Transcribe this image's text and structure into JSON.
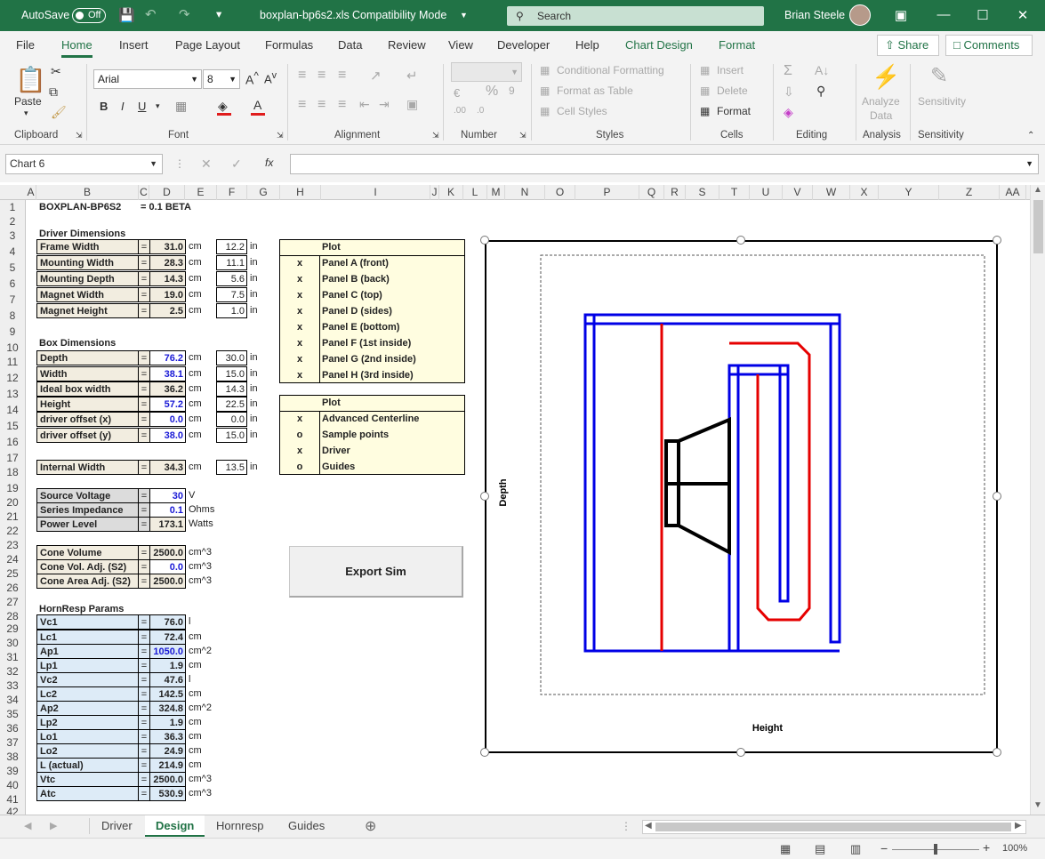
{
  "title": {
    "autosave": "AutoSave",
    "autosave_state": "Off",
    "filename": "boxplan-bp6s2.xls",
    "mode": "Compatibility Mode",
    "search_placeholder": "Search",
    "user": "Brian Steele"
  },
  "menu": [
    "File",
    "Home",
    "Insert",
    "Page Layout",
    "Formulas",
    "Data",
    "Review",
    "View",
    "Developer",
    "Help",
    "Chart Design",
    "Format"
  ],
  "share": "Share",
  "comments": "Comments",
  "ribbon": {
    "clipboard": "Clipboard",
    "paste": "Paste",
    "font": "Font",
    "font_name": "Arial",
    "font_size": "8",
    "alignment": "Alignment",
    "number": "Number",
    "styles": "Styles",
    "conditional_formatting": "Conditional Formatting",
    "format_as_table": "Format as Table",
    "cell_styles": "Cell Styles",
    "cells": "Cells",
    "insert": "Insert",
    "delete": "Delete",
    "format": "Format",
    "editing": "Editing",
    "analysis": "Analysis",
    "analyze_data_1": "Analyze",
    "analyze_data_2": "Data",
    "sensitivity": "Sensitivity"
  },
  "namebox": "Chart 6",
  "columns": [
    "A",
    "B",
    "C",
    "D",
    "E",
    "F",
    "G",
    "H",
    "I",
    "J",
    "K",
    "L",
    "M",
    "N",
    "O",
    "P",
    "Q",
    "R",
    "S",
    "T",
    "U",
    "V",
    "W",
    "X",
    "Y",
    "Z",
    "AA"
  ],
  "rows": [
    "1",
    "2",
    "3",
    "4",
    "5",
    "6",
    "7",
    "8",
    "9",
    "10",
    "11",
    "12",
    "13",
    "14",
    "15",
    "16",
    "17",
    "18",
    "19",
    "20",
    "21",
    "22",
    "23",
    "24",
    "25",
    "26",
    "27",
    "28",
    "29",
    "30",
    "31",
    "32",
    "33",
    "34",
    "35",
    "36",
    "37",
    "38",
    "39",
    "40",
    "41",
    "42"
  ],
  "sheet": {
    "r1_title": "BOXPLAN-BP6S2",
    "r1_version": "=  0.1 BETA",
    "driver_dim": "Driver Dimensions",
    "box_dim": "Box Dimensions",
    "hr_params": "HornResp Params",
    "eq": "=",
    "cm": "cm",
    "in": "in",
    "v": "V",
    "ohms": "Ohms",
    "watts": "Watts",
    "cm3": "cm^3",
    "cm2": "cm^2",
    "l": "l",
    "driver": [
      {
        "label": "Frame Width",
        "v": "31.0",
        "i": "12.2"
      },
      {
        "label": "Mounting Width",
        "v": "28.3",
        "i": "11.1"
      },
      {
        "label": "Mounting Depth",
        "v": "14.3",
        "i": "5.6"
      },
      {
        "label": "Magnet Width",
        "v": "19.0",
        "i": "7.5"
      },
      {
        "label": "Magnet Height",
        "v": "2.5",
        "i": "1.0"
      }
    ],
    "box": [
      {
        "label": "Depth",
        "v": "76.2",
        "i": "30.0"
      },
      {
        "label": "Width",
        "v": "38.1",
        "i": "15.0"
      },
      {
        "label": "Ideal box width",
        "v": "36.2",
        "i": "14.3"
      },
      {
        "label": "Height",
        "v": "57.2",
        "i": "22.5"
      },
      {
        "label": "driver offset (x)",
        "v": "0.0",
        "i": "0.0"
      },
      {
        "label": "driver offset (y)",
        "v": "38.0",
        "i": "15.0"
      }
    ],
    "internal": {
      "label": "Internal Width",
      "v": "34.3",
      "i": "13.5"
    },
    "source": [
      {
        "label": "Source Voltage",
        "v": "30"
      },
      {
        "label": "Series Impedance",
        "v": "0.1"
      },
      {
        "label": "Power Level",
        "v": "173.1"
      }
    ],
    "cone": [
      {
        "label": "Cone Volume",
        "v": "2500.0"
      },
      {
        "label": "Cone Vol. Adj. (S2)",
        "v": "0.0"
      },
      {
        "label": "Cone Area Adj. (S2)",
        "v": "2500.0"
      }
    ],
    "hr": [
      {
        "label": "Vc1",
        "v": "76.0",
        "u": "l"
      },
      {
        "label": "Lc1",
        "v": "72.4",
        "u": "cm"
      },
      {
        "label": "Ap1",
        "v": "1050.0",
        "u": "cm^2"
      },
      {
        "label": "Lp1",
        "v": "1.9",
        "u": "cm"
      },
      {
        "label": "Vc2",
        "v": "47.6",
        "u": "l"
      },
      {
        "label": "Lc2",
        "v": "142.5",
        "u": "cm"
      },
      {
        "label": "Ap2",
        "v": "324.8",
        "u": "cm^2"
      },
      {
        "label": "Lp2",
        "v": "1.9",
        "u": "cm"
      },
      {
        "label": "Lo1",
        "v": "36.3",
        "u": "cm"
      },
      {
        "label": "Lo2",
        "v": "24.9",
        "u": "cm"
      },
      {
        "label": "L (actual)",
        "v": "214.9",
        "u": "cm"
      },
      {
        "label": "Vtc",
        "v": "2500.0",
        "u": "cm^3"
      },
      {
        "label": "Atc",
        "v": "530.9",
        "u": "cm^3"
      }
    ],
    "plot1_title": "Plot",
    "plot1": [
      {
        "m": "x",
        "label": "Panel A (front)"
      },
      {
        "m": "x",
        "label": "Panel B (back)"
      },
      {
        "m": "x",
        "label": "Panel C (top)"
      },
      {
        "m": "x",
        "label": "Panel D (sides)"
      },
      {
        "m": "x",
        "label": "Panel E (bottom)"
      },
      {
        "m": "x",
        "label": "Panel F (1st inside)"
      },
      {
        "m": "x",
        "label": "Panel G (2nd inside)"
      },
      {
        "m": "x",
        "label": "Panel H (3rd inside)"
      }
    ],
    "plot2_title": "Plot",
    "plot2": [
      {
        "m": "x",
        "label": "Advanced Centerline"
      },
      {
        "m": "o",
        "label": "Sample points"
      },
      {
        "m": "x",
        "label": "Driver"
      },
      {
        "m": "o",
        "label": "Guides"
      }
    ],
    "export_button": "Export Sim"
  },
  "chart": {
    "ylabel": "Depth",
    "xlabel": "Height"
  },
  "tabs": [
    "Driver",
    "Design",
    "Hornresp",
    "Guides"
  ],
  "zoom": "100%"
}
